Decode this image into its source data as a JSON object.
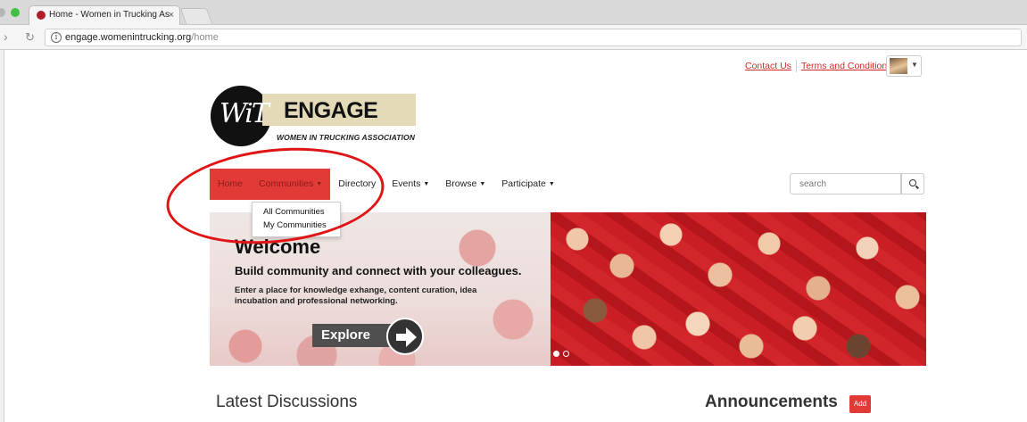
{
  "browser": {
    "tab_title": "Home - Women in Trucking As",
    "url_domain": "engage.womenintrucking.org",
    "url_path": "/home",
    "info_glyph": "i"
  },
  "utility": {
    "contact_us": "Contact Us",
    "terms": "Terms and Conditions"
  },
  "logo": {
    "mark": "WiT",
    "name": "ENGAGE",
    "subtitle": "WOMEN IN TRUCKING ASSOCIATION"
  },
  "nav": {
    "items": [
      {
        "label": "Home"
      },
      {
        "label": "Communities"
      },
      {
        "label": "Directory"
      },
      {
        "label": "Events"
      },
      {
        "label": "Browse"
      },
      {
        "label": "Participate"
      }
    ]
  },
  "search": {
    "placeholder": "search"
  },
  "dropdown": {
    "items": [
      "All Communities",
      "My Communities"
    ]
  },
  "hero": {
    "title": "Welcome",
    "tagline": "Build community and connect with your colleagues.",
    "description": "Enter a place for knowledge exhange, content curation, idea incubation and professional networking.",
    "button": "Explore",
    "active_slide": 1,
    "slide_count": 2
  },
  "sections": {
    "latest": "Latest Discussions",
    "announcements": "Announcements",
    "add": "Add"
  },
  "colors": {
    "accent_red": "#e23a36",
    "link_red": "#d12b2b",
    "annotation_red": "#e01414"
  }
}
